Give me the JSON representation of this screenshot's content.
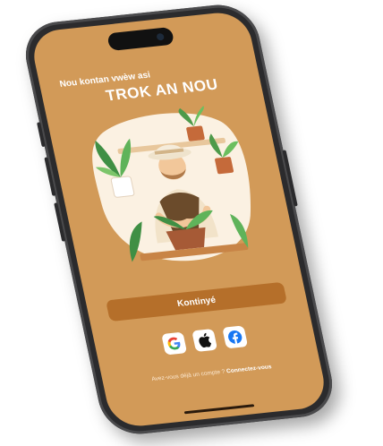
{
  "onboarding": {
    "subtitle": "Nou kontan vwèw asi",
    "title": "TROK AN NOU",
    "continue_label": "Kontinyé",
    "footer_text": "Avez-vous déjà un compte ?",
    "footer_link": "Connectez-vous"
  },
  "social_login": {
    "providers": [
      "google-icon",
      "apple-icon",
      "facebook-icon"
    ]
  },
  "colors": {
    "screen_background": "#d29a58",
    "button_background": "#b56f2a",
    "phone_frame": "#2b2b2d"
  }
}
